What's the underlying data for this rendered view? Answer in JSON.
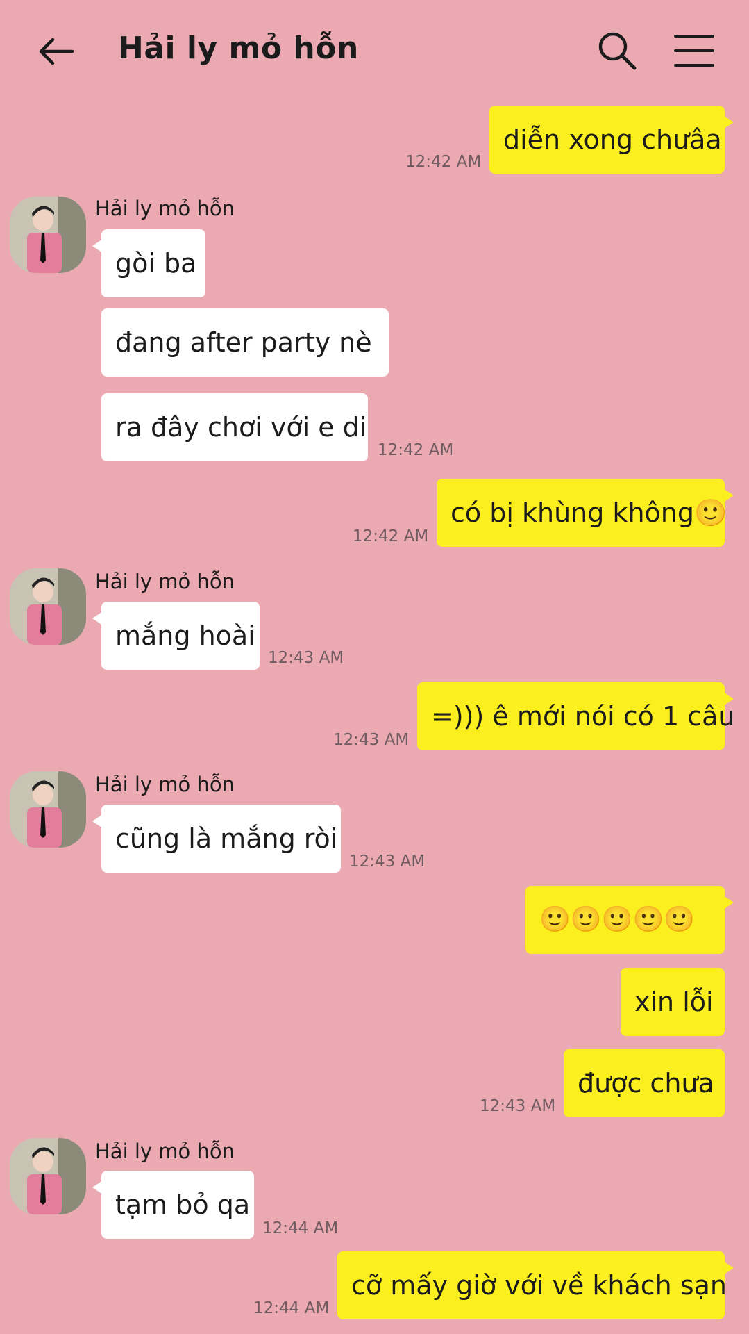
{
  "header": {
    "title": "Hải ly mỏ hỗn"
  },
  "contact": {
    "name": "Hải ly mỏ hỗn"
  },
  "messages": [
    {
      "dir": "out",
      "text": "diễn xong chưâa",
      "time": "12:42 AM"
    },
    {
      "dir": "in",
      "text": "gòi ba"
    },
    {
      "dir": "in",
      "text": "đang after party nè"
    },
    {
      "dir": "in",
      "text": "ra đây chơi với e di",
      "time": "12:42 AM"
    },
    {
      "dir": "out",
      "text": "có bị khùng không🙂",
      "time": "12:42 AM"
    },
    {
      "dir": "in",
      "text": "mắng hoài",
      "time": "12:43 AM"
    },
    {
      "dir": "out",
      "text": "=))) ê mới nói có 1 câu",
      "time": "12:43 AM"
    },
    {
      "dir": "in",
      "text": "cũng là mắng ròi",
      "time": "12:43 AM"
    },
    {
      "dir": "out",
      "text": "🙂🙂🙂🙂🙂"
    },
    {
      "dir": "out",
      "text": "xin lỗi"
    },
    {
      "dir": "out",
      "text": "được chưa",
      "time": "12:43 AM"
    },
    {
      "dir": "in",
      "text": "tạm bỏ qa",
      "time": "12:44 AM"
    },
    {
      "dir": "out",
      "text": "cỡ mấy giờ với về khách sạn",
      "time": "12:44 AM"
    }
  ],
  "icons": {
    "back": "arrow-left-icon",
    "search": "search-icon",
    "menu": "hamburger-menu-icon"
  },
  "colors": {
    "background": "#eba9b2",
    "incoming_bubble": "#ffffff",
    "outgoing_bubble": "#fcef1f",
    "timestamp": "#6f5b60"
  }
}
